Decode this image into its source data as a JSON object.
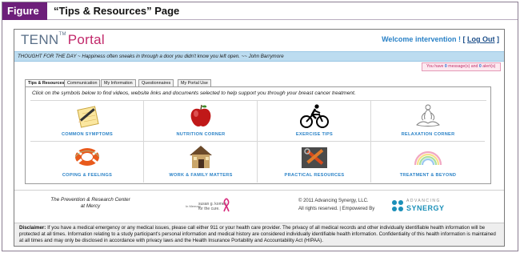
{
  "figure": {
    "badge": "Figure",
    "title": "“Tips & Resources” Page"
  },
  "header": {
    "logo_main": "TENN",
    "logo_tm": "TM",
    "logo_portal": "Portal",
    "welcome": "Welcome intervention !",
    "logout_open": "[",
    "logout_label": "Log Out",
    "logout_close": "]"
  },
  "thought": "THOUGHT FOR THE DAY ~ Happiness often sneaks in through a door you didn't know you left open. ~~ John Barrymore",
  "messages": {
    "prefix": "You have",
    "message_count": "0",
    "middle": "message(s) and",
    "alert_count": "0",
    "suffix": "alert(s)"
  },
  "tabs": [
    {
      "label": "Tips & Resources",
      "active": true
    },
    {
      "label": "Communication",
      "active": false
    },
    {
      "label": "My Information",
      "active": false
    },
    {
      "label": "Questionnaires",
      "active": false
    },
    {
      "label": "My Portal Use",
      "active": false
    }
  ],
  "instructions": "Click on the symbols below to find videos, website links and documents selected to help support you through your breast cancer treatment.",
  "categories": [
    {
      "label": "Common Symptoms",
      "icon": "pencil-notepad-icon"
    },
    {
      "label": "Nutrition Corner",
      "icon": "apple-icon"
    },
    {
      "label": "Exercise Tips",
      "icon": "cyclist-icon"
    },
    {
      "label": "Relaxation Corner",
      "icon": "meditation-icon"
    },
    {
      "label": "Coping & feelings",
      "icon": "life-ring-icon"
    },
    {
      "label": "Work & Family Matters",
      "icon": "house-icon"
    },
    {
      "label": "Practical Resources",
      "icon": "tools-icon"
    },
    {
      "label": "Treatment & Beyond",
      "icon": "rainbow-icon"
    }
  ],
  "footer": {
    "prc_line1": "The Prevention & Research Center",
    "prc_line2": "at Mercy",
    "komen_small": "In Memory",
    "komen_name": "susan g. komen",
    "komen_suffix": "for the cure.",
    "copyright_line1": "© 2011 Advancing Synergy, LLC.",
    "copyright_line2": "All rights reserved.  |  Empowered By",
    "synergy_top": "ADVANCING",
    "synergy_bottom": "SYNERGY"
  },
  "disclaimer": {
    "label": "Disclaimer:",
    "text": "If you have a medical emergency or any medical issues, please call either 911 or your health care provider. The privacy of all medical records and other individually identifiable health information will be protected at all times. Information relating to a study participant's personal information and medical history are considered individually identifiable health information. Confidentiality of this health information is maintained at all times and may only be disclosed in accordance with privacy laws and the Health Insurance Portability and Accountability Act (HIPAA)."
  },
  "colors": {
    "figure_badge": "#6d1f7a",
    "link_blue": "#2a82c7",
    "brand_pink": "#c2286a",
    "thought_bar": "#bcdcf0"
  }
}
